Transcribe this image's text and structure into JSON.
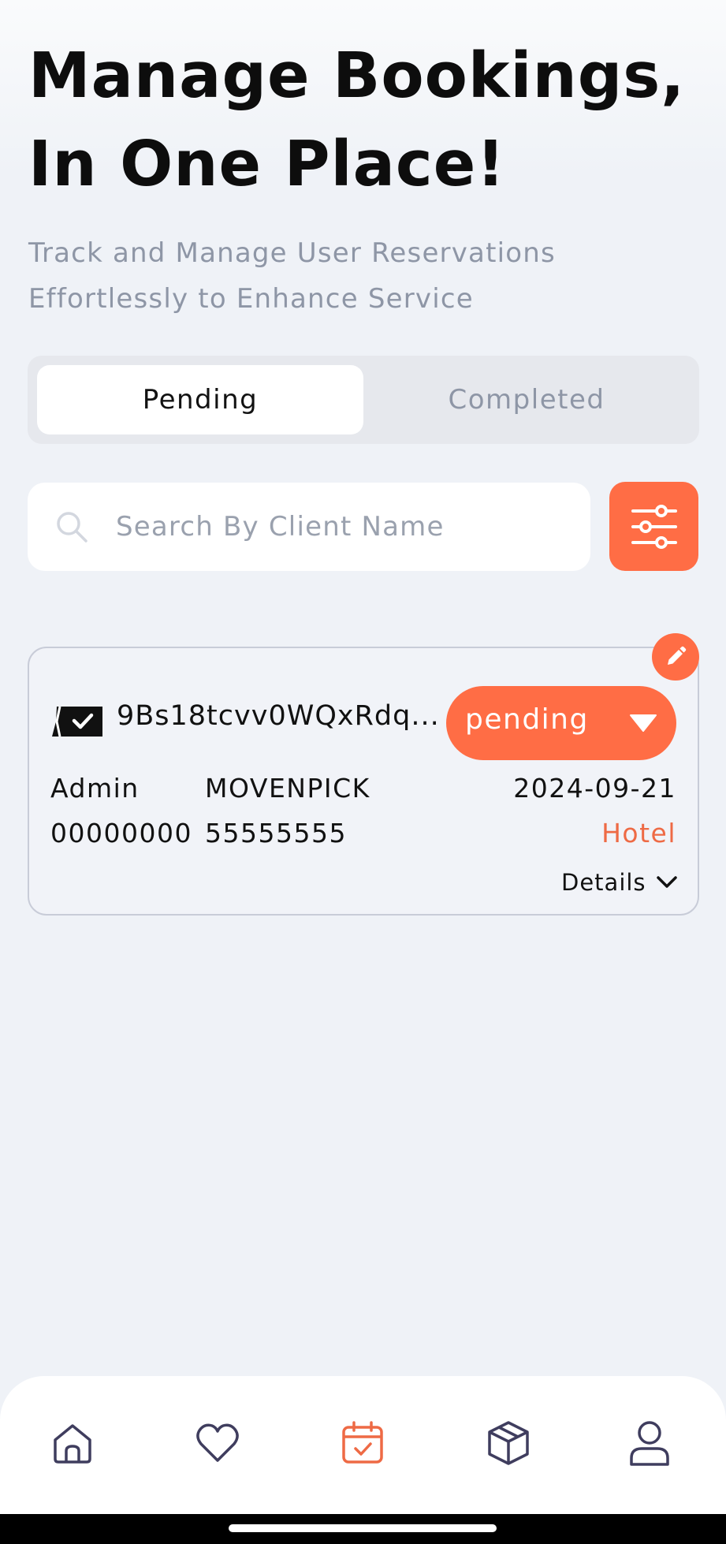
{
  "header": {
    "title_line1": "Manage Bookings,",
    "title_line2": "In One Place!",
    "subtitle_line1": "Track and Manage User Reservations",
    "subtitle_line2": "Effortlessly to Enhance Service"
  },
  "tabs": {
    "pending": "Pending",
    "completed": "Completed",
    "active": "pending"
  },
  "search": {
    "placeholder": "Search By Client Name",
    "value": ""
  },
  "booking": {
    "id": "9Bs18tcvv0WQxRdq...",
    "status": "pending",
    "client": "Admin",
    "phone": "00000000",
    "property": "MOVENPICK",
    "property_phone": "55555555",
    "date": "2024-09-21",
    "type": "Hotel",
    "details_label": "Details"
  },
  "colors": {
    "accent": "#ff6d45",
    "background": "#eff2f7",
    "nav_icon": "#3f3d5e",
    "muted_text": "#8e96a6"
  },
  "nav": {
    "items": [
      {
        "icon": "home-icon",
        "active": false
      },
      {
        "icon": "heart-icon",
        "active": false
      },
      {
        "icon": "calendar-check-icon",
        "active": true
      },
      {
        "icon": "package-icon",
        "active": false
      },
      {
        "icon": "user-icon",
        "active": false
      }
    ]
  }
}
